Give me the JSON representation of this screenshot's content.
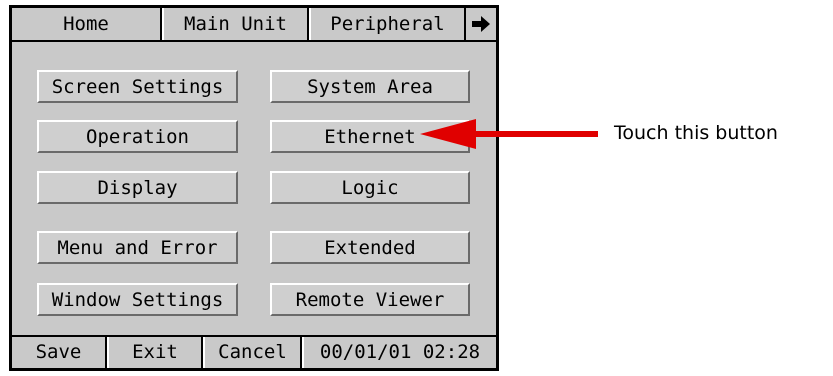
{
  "tabs": {
    "home": "Home",
    "main_unit": "Main Unit",
    "peripheral": "Peripheral",
    "next_icon": "right-arrow-icon"
  },
  "buttons": {
    "screen_settings": "Screen Settings",
    "system_area": "System Area",
    "operation": "Operation",
    "ethernet": "Ethernet",
    "display": "Display",
    "logic": "Logic",
    "menu_and_error": "Menu and Error",
    "extended": "Extended",
    "window_settings": "Window Settings",
    "remote_viewer": "Remote Viewer"
  },
  "bottom_bar": {
    "save": "Save",
    "exit": "Exit",
    "cancel": "Cancel",
    "datetime": "00/01/01 02:28"
  },
  "annotation": {
    "text": "Touch this button",
    "arrow_color": "#e00000"
  },
  "colors": {
    "panel_bg": "#c9c9c9",
    "border": "#000000"
  }
}
